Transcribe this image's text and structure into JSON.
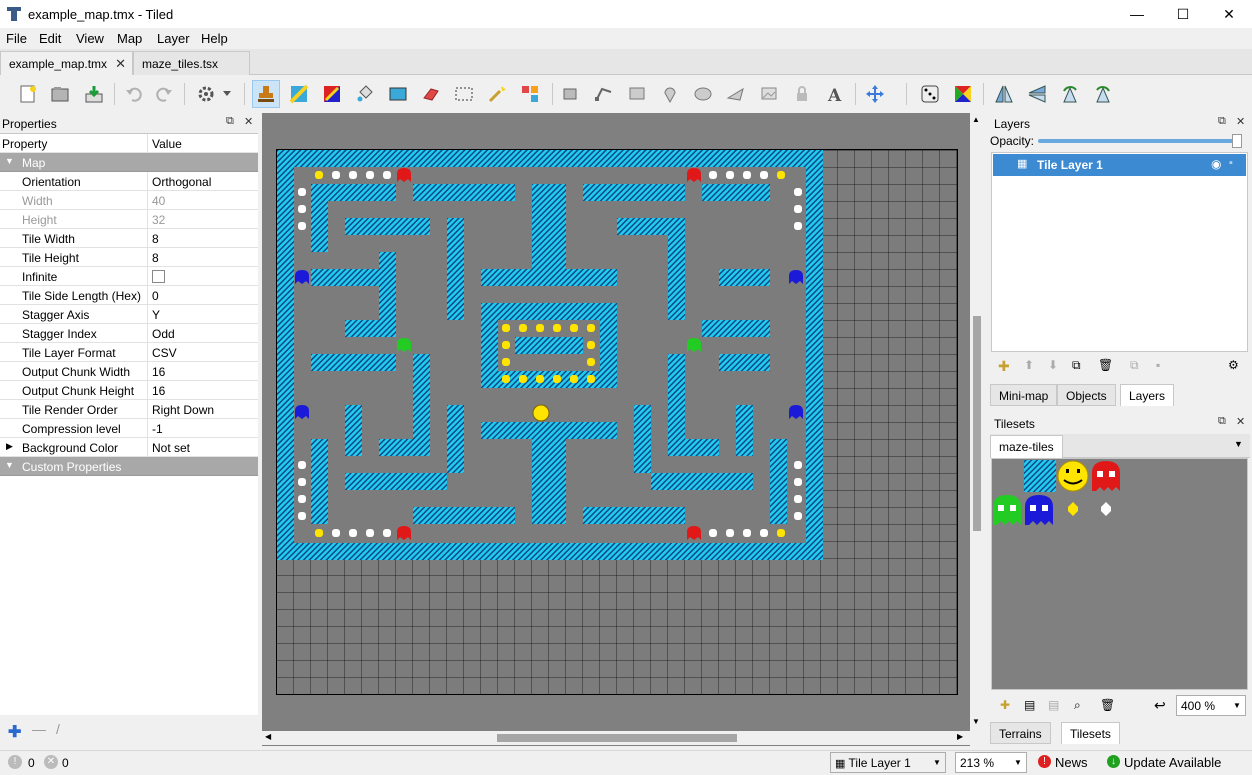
{
  "window": {
    "title": "example_map.tmx - Tiled",
    "minimize": "—",
    "maximize": "☐",
    "close": "✕"
  },
  "menu": [
    "File",
    "Edit",
    "View",
    "Map",
    "Layer",
    "Help"
  ],
  "tabs": [
    {
      "label": "example_map.tmx",
      "close": "✕"
    },
    {
      "label": "maze_tiles.tsx"
    }
  ],
  "properties": {
    "title": "Properties",
    "col_property": "Property",
    "col_value": "Value",
    "group_map": "Map",
    "rows": [
      {
        "k": "Orientation",
        "v": "Orthogonal"
      },
      {
        "k": "Width",
        "v": "40"
      },
      {
        "k": "Height",
        "v": "32"
      },
      {
        "k": "Tile Width",
        "v": "8"
      },
      {
        "k": "Tile Height",
        "v": "8"
      },
      {
        "k": "Infinite",
        "v": ""
      },
      {
        "k": "Tile Side Length (Hex)",
        "v": "0"
      },
      {
        "k": "Stagger Axis",
        "v": "Y"
      },
      {
        "k": "Stagger Index",
        "v": "Odd"
      },
      {
        "k": "Tile Layer Format",
        "v": "CSV"
      },
      {
        "k": "Output Chunk Width",
        "v": "16"
      },
      {
        "k": "Output Chunk Height",
        "v": "16"
      },
      {
        "k": "Tile Render Order",
        "v": "Right Down"
      },
      {
        "k": "Compression level",
        "v": "-1"
      },
      {
        "k": "Background Color",
        "v": "Not set"
      }
    ],
    "group_custom": "Custom Properties"
  },
  "layers": {
    "title": "Layers",
    "opacity_label": "Opacity:",
    "opacity": 1.0,
    "layer_name": "Tile Layer 1",
    "tabs": [
      "Mini-map",
      "Objects",
      "Layers"
    ]
  },
  "tilesets": {
    "title": "Tilesets",
    "tab": "maze-tiles",
    "zoom": "400 %",
    "bottom_tabs": [
      "Terrains",
      "Tilesets"
    ]
  },
  "status": {
    "warnings": "0",
    "errors": "0",
    "layer": "Tile Layer 1",
    "zoom": "213 %",
    "news": "News",
    "update": "Update Available"
  },
  "colors": {
    "wall": "#22ccee",
    "floor": "#7c7c7c",
    "selection": "#3c8ad1"
  }
}
